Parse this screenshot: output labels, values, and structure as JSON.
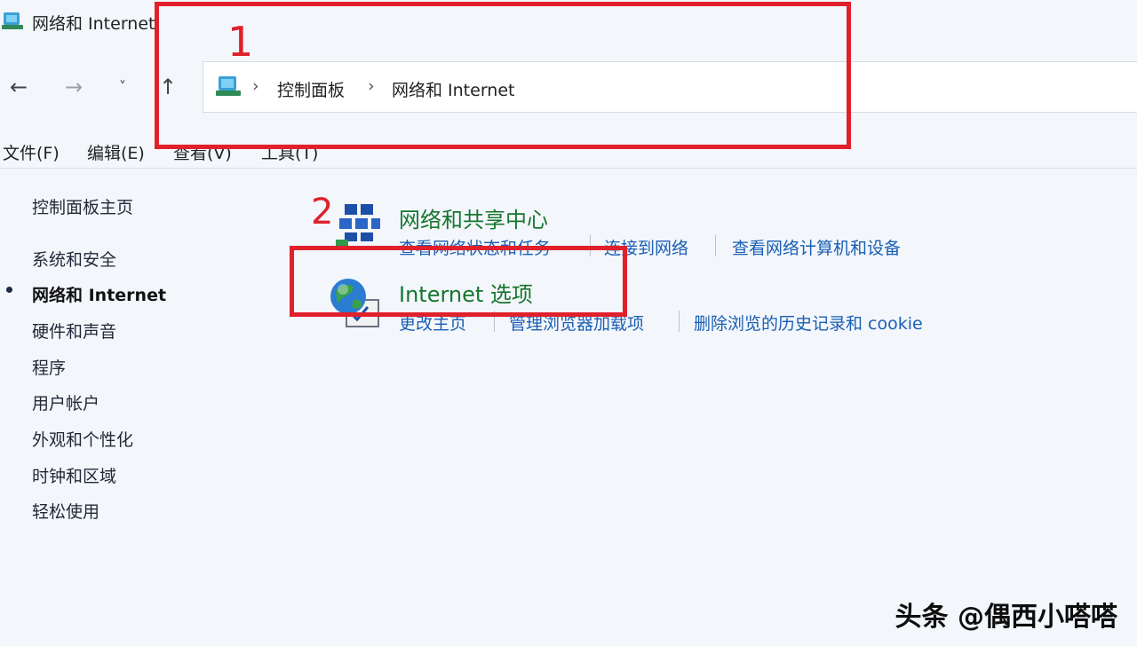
{
  "window": {
    "title": "网络和 Internet"
  },
  "nav": {
    "back": "←",
    "forward": "→",
    "recent": "˅",
    "up": "↑"
  },
  "address_bar": {
    "icon": "control-panel-icon",
    "breadcrumbs": [
      "控制面板",
      "网络和 Internet"
    ],
    "separator": "›"
  },
  "menu": [
    "文件(F)",
    "编辑(E)",
    "查看(V)",
    "工具(T)"
  ],
  "sidebar": {
    "home": "控制面板主页",
    "items": [
      {
        "label": "系统和安全",
        "active": false
      },
      {
        "label": "网络和 Internet",
        "active": true
      },
      {
        "label": "硬件和声音",
        "active": false
      },
      {
        "label": "程序",
        "active": false
      },
      {
        "label": "用户帐户",
        "active": false
      },
      {
        "label": "外观和个性化",
        "active": false
      },
      {
        "label": "时钟和区域",
        "active": false
      },
      {
        "label": "轻松使用",
        "active": false
      }
    ]
  },
  "categories": [
    {
      "title": "网络和共享中心",
      "icon": "network-sharing-icon",
      "links": [
        "查看网络状态和任务",
        "连接到网络",
        "查看网络计算机和设备"
      ]
    },
    {
      "title": "Internet 选项",
      "icon": "internet-options-globe-icon",
      "links": [
        "更改主页",
        "管理浏览器加载项",
        "删除浏览的历史记录和 cookie"
      ]
    }
  ],
  "annotations": {
    "label_1": "1",
    "label_2": "2",
    "color": "#e0202a"
  },
  "watermark": "头条 @偶西小嗒嗒"
}
